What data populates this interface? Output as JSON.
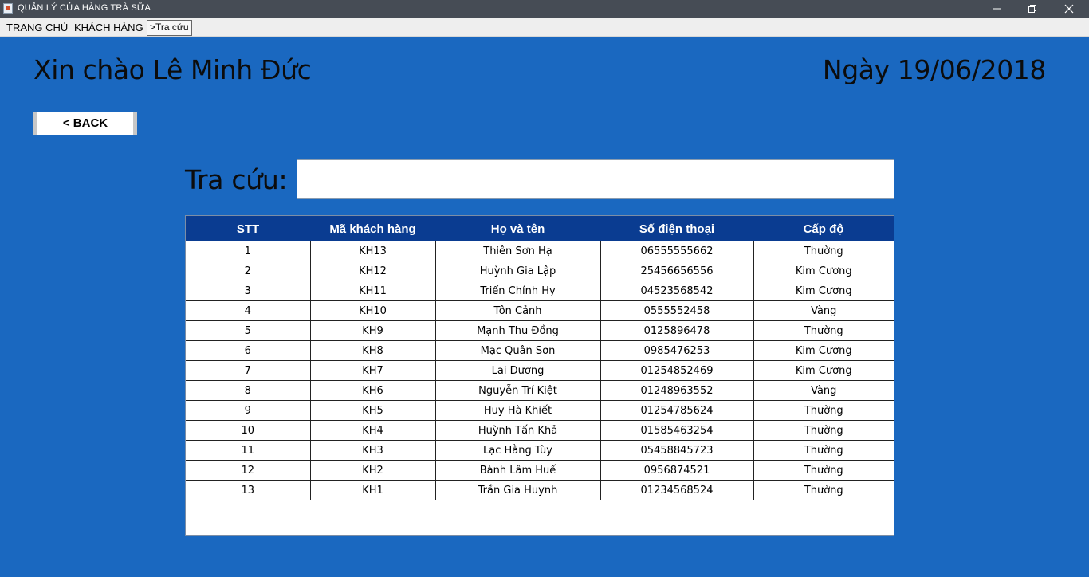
{
  "window": {
    "title": "QUẢN LÝ CỬA HÀNG TRÀ SỮA"
  },
  "menu": {
    "items": [
      {
        "label": "TRANG CHỦ"
      },
      {
        "label": "KHÁCH HÀNG"
      },
      {
        "label": ">Tra cứu"
      }
    ]
  },
  "header": {
    "greeting": "Xin chào Lê Minh Đức",
    "date": "Ngày 19/06/2018"
  },
  "back_button": {
    "label": "< BACK"
  },
  "search": {
    "label": "Tra cứu:",
    "value": ""
  },
  "table": {
    "columns": [
      "STT",
      "Mã khách hàng",
      "Họ và tên",
      "Số điện thoại",
      "Cấp độ"
    ],
    "rows": [
      [
        "1",
        "KH13",
        "Thiên Sơn Hạ",
        "06555555662",
        "Thường"
      ],
      [
        "2",
        "KH12",
        "Huỳnh Gia Lập",
        "25456656556",
        "Kim Cương"
      ],
      [
        "3",
        "KH11",
        "Triển Chính Hy",
        "04523568542",
        "Kim Cương"
      ],
      [
        "4",
        "KH10",
        "Tôn Cảnh",
        "0555552458",
        "Vàng"
      ],
      [
        "5",
        "KH9",
        "Mạnh Thu Đồng",
        "0125896478",
        "Thường"
      ],
      [
        "6",
        "KH8",
        "Mạc Quân Sơn",
        "0985476253",
        "Kim Cương"
      ],
      [
        "7",
        "KH7",
        "Lai Dương",
        "01254852469",
        "Kim Cương"
      ],
      [
        "8",
        "KH6",
        "Nguyễn Trí Kiệt",
        "01248963552",
        "Vàng"
      ],
      [
        "9",
        "KH5",
        "Huy Hà Khiết",
        "01254785624",
        "Thường"
      ],
      [
        "10",
        "KH4",
        "Huỳnh Tấn Khả",
        "01585463254",
        "Thường"
      ],
      [
        "11",
        "KH3",
        "Lạc Hằng Tùy",
        "05458845723",
        "Thường"
      ],
      [
        "12",
        "KH2",
        "Bành Lâm Huế",
        "0956874521",
        "Thường"
      ],
      [
        "13",
        "KH1",
        "Trần Gia Huynh",
        "01234568524",
        "Thường"
      ]
    ]
  },
  "colors": {
    "background": "#1a68c0",
    "table_header": "#0a3c91",
    "titlebar": "#464c55"
  },
  "icons": [
    "app-icon",
    "minimize-icon",
    "restore-icon",
    "close-icon"
  ]
}
